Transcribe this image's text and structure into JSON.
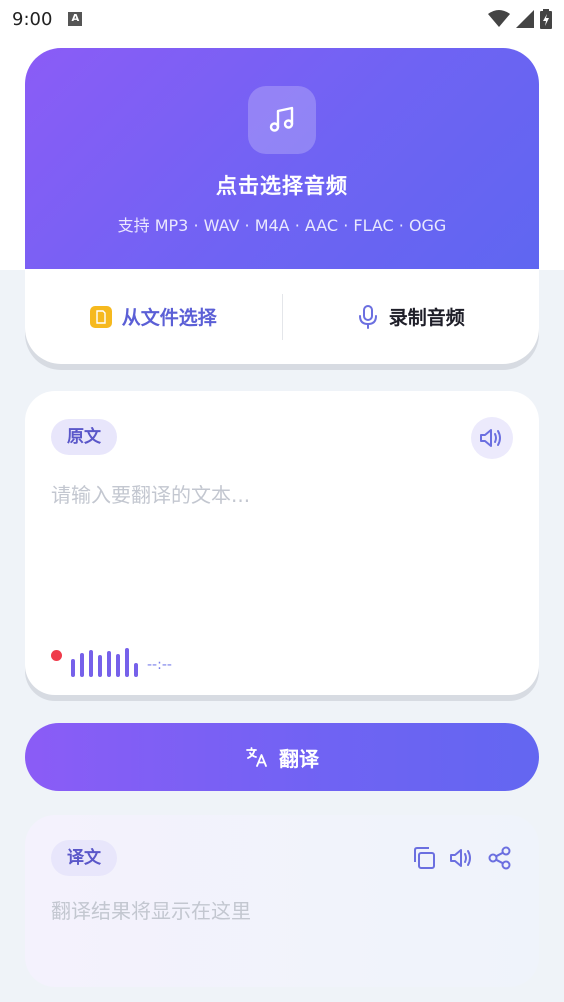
{
  "status_bar": {
    "time": "9:00",
    "notification_letter": "A"
  },
  "upload": {
    "title": "点击选择音频",
    "formats": "支持 MP3 · WAV · M4A · AAC · FLAC · OGG",
    "file_button": "从文件选择",
    "record_button": "录制音频"
  },
  "source": {
    "tag": "原文",
    "placeholder": "请输入要翻译的文本...",
    "timer": "--:--",
    "wave_levels": [
      0.55,
      0.75,
      0.85,
      0.7,
      0.8,
      0.72,
      0.9,
      0.45
    ]
  },
  "translate": {
    "label": "翻译"
  },
  "result": {
    "tag": "译文",
    "placeholder": "翻译结果将显示在这里"
  },
  "colors": {
    "accent": "#6f63f3",
    "accent_light": "#8b5cf6",
    "record_dot": "#ef3b4b",
    "file_icon": "#f6b91e"
  },
  "icons": [
    "music-note-icon",
    "file-icon",
    "microphone-icon",
    "speaker-icon",
    "translate-icon",
    "copy-icon",
    "share-icon",
    "wifi-icon",
    "signal-icon",
    "battery-icon"
  ]
}
